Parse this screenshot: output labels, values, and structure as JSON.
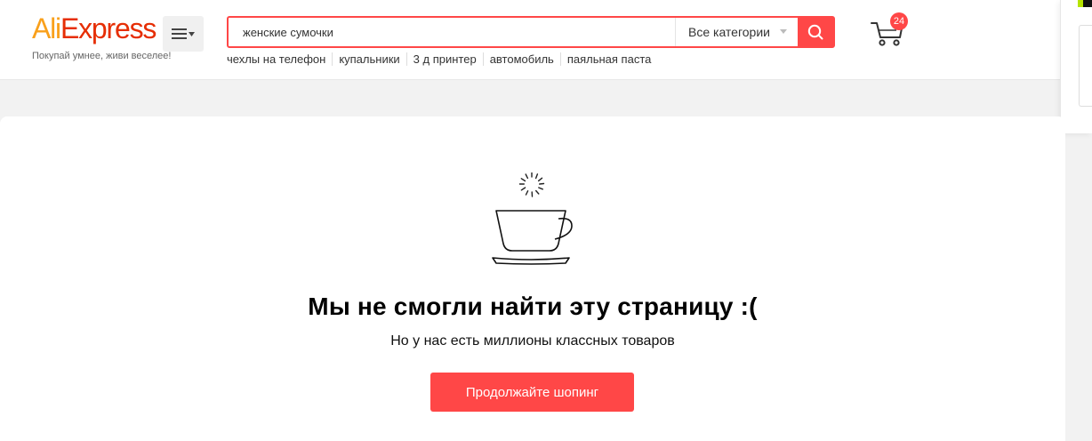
{
  "header": {
    "logo": {
      "part_a": "Ali",
      "part_b": "Express"
    },
    "tagline": "Покупай умнее, живи веселее!",
    "menu_icon": "hamburger-menu-icon"
  },
  "search": {
    "value": "женские сумочки",
    "category": "Все категории",
    "button_icon": "search-icon"
  },
  "hot_searches": [
    "чехлы на телефон",
    "купальники",
    "3 д принтер",
    "автомобиль",
    "паяльная паста"
  ],
  "cart": {
    "count": "24",
    "icon": "cart-icon"
  },
  "error_page": {
    "illustration": "coffee-cup-icon",
    "title": "Мы не смогли найти эту страницу :(",
    "subtitle": "Но у нас есть миллионы классных товаров",
    "cta_label": "Продолжайте шопинг"
  },
  "colors": {
    "accent": "#ff4747",
    "logo_orange": "#f9a01b",
    "logo_red": "#e62e04"
  }
}
